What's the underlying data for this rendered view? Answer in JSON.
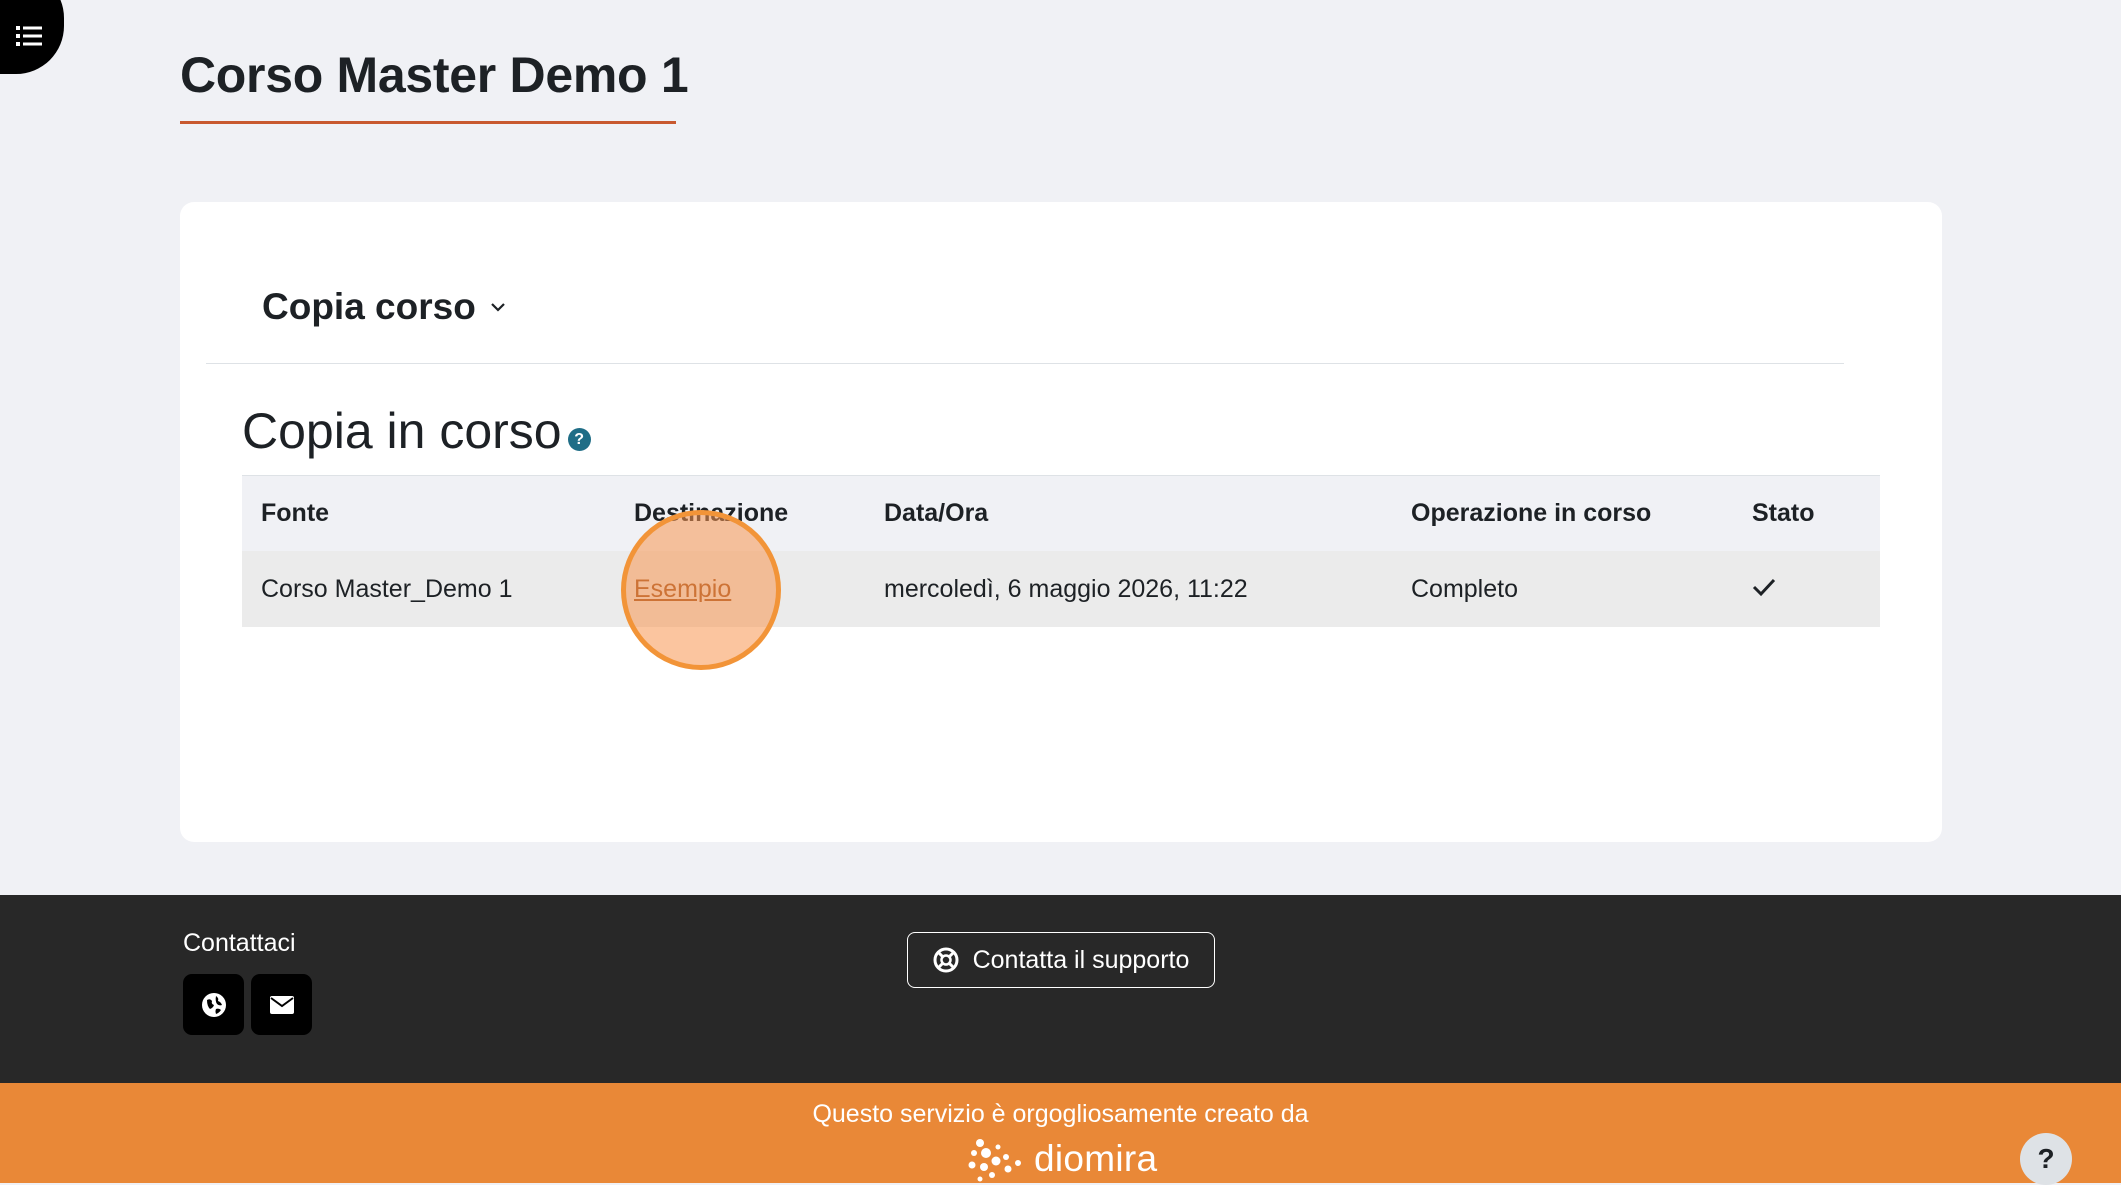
{
  "page": {
    "title": "Corso Master Demo 1"
  },
  "section_selector": {
    "label": "Copia corso"
  },
  "copy_table": {
    "heading": "Copia in corso",
    "help_glyph": "?",
    "columns": [
      "Fonte",
      "Destinazione",
      "Data/Ora",
      "Operazione in corso",
      "Stato"
    ],
    "rows": [
      {
        "source": "Corso Master_Demo 1",
        "destination": "Esempio",
        "datetime": "mercoledì, 6 maggio 2026, 11:22",
        "operation": "Completo",
        "status_icon": "check-icon"
      }
    ]
  },
  "footer": {
    "contact_title": "Contattaci",
    "social_icons": [
      "globe-icon",
      "envelope-icon"
    ],
    "support_button": "Contatta il supporto"
  },
  "powered_by": {
    "text": "Questo servizio è orgogliosamente creato da",
    "brand": "diomira"
  },
  "help_fab": {
    "label": "?"
  },
  "colors": {
    "accent_underline": "#c8592f",
    "footer_bg": "#282828",
    "powered_bg": "#e98837",
    "help_icon": "#1f6d86",
    "highlight_ring": "#f29438"
  }
}
